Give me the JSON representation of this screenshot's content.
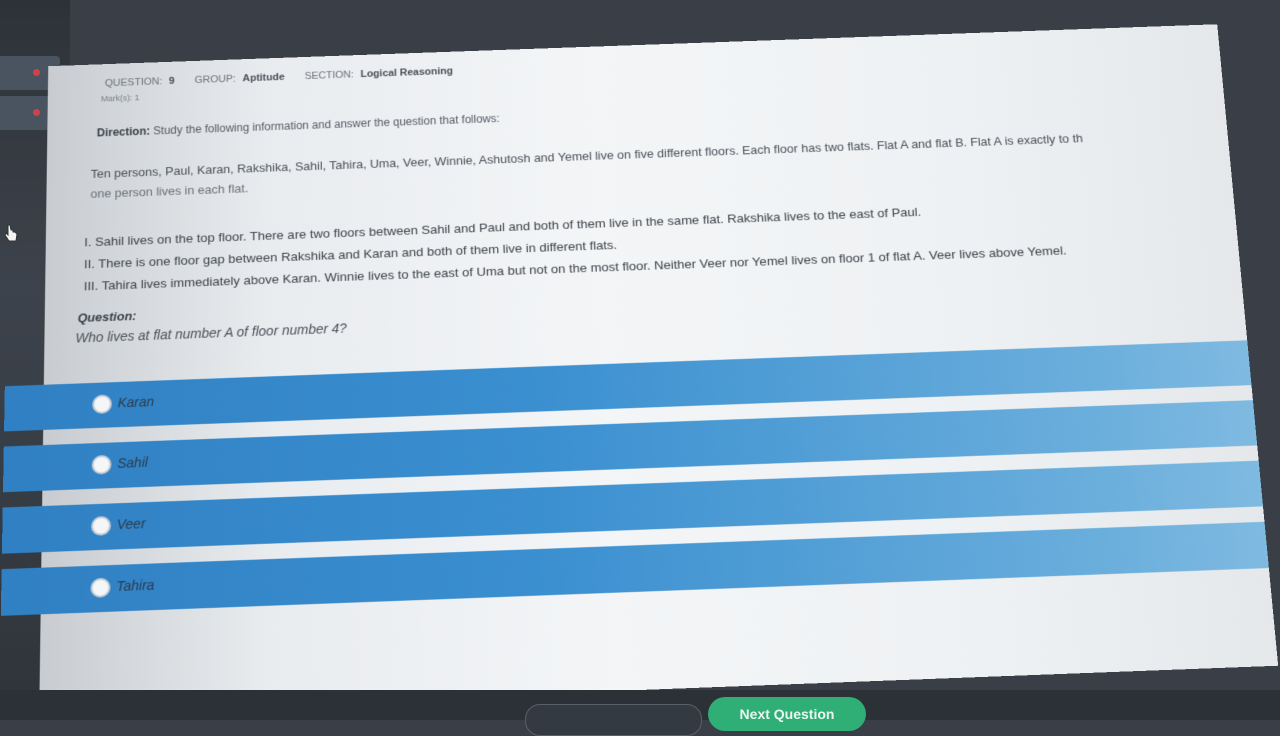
{
  "header": {
    "question_label": "QUESTION:",
    "question_number": "9",
    "group_label": "GROUP:",
    "group_value": "Aptitude",
    "section_label": "SECTION:",
    "section_value": "Logical Reasoning",
    "marks": "Mark(s): 1"
  },
  "direction": {
    "label": "Direction:",
    "text": "Study the following information and answer the question that follows:"
  },
  "passage": {
    "line1": "Ten persons, Paul, Karan, Rakshika, Sahil, Tahira, Uma, Veer, Winnie, Ashutosh and Yemel live on five different floors. Each floor has two flats. Flat A and flat B. Flat A is exactly to th",
    "line2": "one person lives in each flat."
  },
  "statements": [
    "I. Sahil lives on the top floor. There are two floors between Sahil and Paul and both of them live in the same flat. Rakshika lives to the east of Paul.",
    "II. There is one floor gap between Rakshika and Karan and both of them live in different flats.",
    "III. Tahira lives immediately above Karan. Winnie lives to the east of Uma but not on the most floor. Neither Veer nor Yemel lives on floor 1 of flat A. Veer lives above Yemel."
  ],
  "question": {
    "heading": "Question:",
    "text": "Who lives at flat number A of floor number 4?"
  },
  "options": [
    {
      "label": "Karan"
    },
    {
      "label": "Sahil"
    },
    {
      "label": "Veer"
    },
    {
      "label": "Tahira"
    }
  ],
  "footer": {
    "next_label": "Next Question"
  },
  "colors": {
    "option_bar": "#3a8fd0",
    "next_button": "#2fae76"
  }
}
